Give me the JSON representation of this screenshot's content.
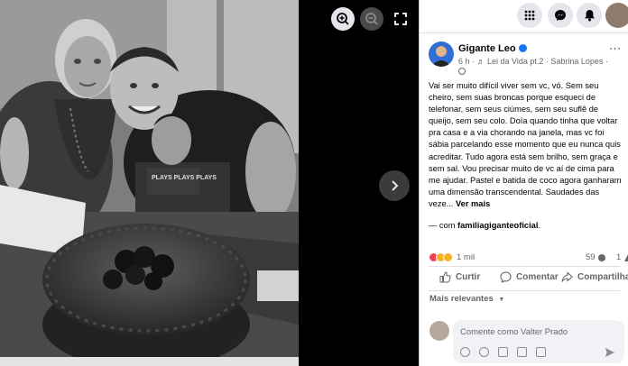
{
  "post": {
    "author": "Gigante Leo",
    "meta": "6 h · ♬ Lei da Vida pt.2 · Sabrina Lopes · ",
    "text": "Vai ser muito difícil viver sem vc, vó. Sem seu cheiro, sem suas broncas porque esqueci de telefonar, sem seus ciúmes, sem seu suflê de queijo, sem seu colo. Doía quando tinha que voltar pra casa e a via chorando na janela, mas vc foi sábia parcelando esse momento que eu nunca quis acreditar. Tudo agora está sem brilho, sem graça e sem sal. Vou precisar muito de vc aí de cima para me ajudar. Pastel e batida de coco agora ganharam uma dimensão transcendental. Saudades das veze...",
    "see_more": "Ver mais",
    "with_prefix": "— com ",
    "with_name": "familiagiganteoficial",
    "with_suffix": "."
  },
  "stats": {
    "reactions_count": "1 mil",
    "comments_count": "59",
    "shares_count": "1"
  },
  "actions": {
    "like": "Curtir",
    "comment": "Comentar",
    "share": "Compartilha"
  },
  "comments": {
    "sort_label": "Mais relevantes",
    "placeholder": "Comente como Valter Prado"
  },
  "photo": {
    "shirt_text": "PLAYS PLAYS PLAYS"
  },
  "icons": {
    "zoom_in": "zoom-in-icon",
    "zoom_out": "zoom-out-icon",
    "fullscreen": "fullscreen-icon",
    "next": "chevron-right-icon",
    "menu": "grid-menu-icon",
    "messenger": "messenger-icon",
    "notifications": "bell-icon"
  },
  "colors": {
    "accent": "#1877f2",
    "viewer_bg": "#000000",
    "panel_bg": "#ffffff",
    "muted_text": "#65676b"
  }
}
